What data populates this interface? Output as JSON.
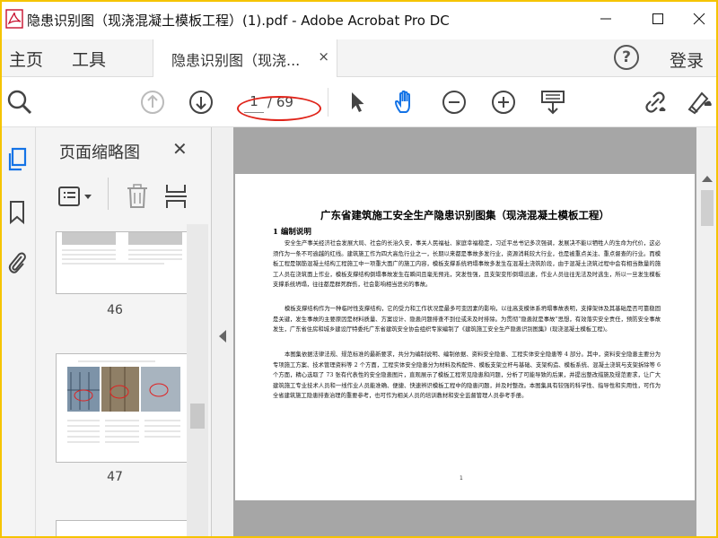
{
  "window": {
    "title": "隐患识别图（现浇混凝土模板工程）(1).pdf - Adobe Acrobat Pro DC"
  },
  "menu": {
    "home": "主页",
    "tools": "工具",
    "tab_label": "隐患识别图（现浇...",
    "tab_close": "×",
    "help": "?",
    "login": "登录"
  },
  "toolbar": {
    "current_page": "1",
    "total_pages": "/ 69"
  },
  "panel": {
    "title": "页面缩略图",
    "close": "✕",
    "thumbnails": [
      {
        "label": "46"
      },
      {
        "label": "47"
      }
    ]
  },
  "document": {
    "heading": "广东省建筑施工安全生产隐患识别图集（现浇混凝土模板工程）",
    "section": "1 编制说明",
    "paragraphs": [
      "安全生产事关经济社会发展大局、社会的长治久安，事关人民福祉、家庭幸福稳定，习近平总书记多次强调，发展决不能以牺牲人的生命为代价，这必须作为一条不可逾越的红线。建筑施工作为四大高危行业之一，长期以来都是事故多发行业，资源消耗较大行业，也是被重点关注、重点督查的行业。而模板工程是钢筋混凝土结构工程施工中一项重大面广的施工内容，模板支撑系统坍塌事故多发生在混凝土浇筑阶段，由于混凝土浇筑过程中会有相当数量的施工人员在浇筑面上作业，模板支撑结构倒塌事故发生在瞬间且毫无预兆，突发性强，且支架变形倒塌迅速，作业人员往往无法及时逃生，所以一旦发生模板支撑系统坍塌，往往都是群死群伤，社会影响相当恶劣的事故。",
      "模板支撑结构作为一种临时性支撑结构，它的受力和工作状况是最多可变因素的影响，以往高支模体系坍塌事故表明，支撑架体及其基础是否可靠稳固是关键，发生事故的主要原因是材料质量、方案设计、隐患问题排查不到位或未及时排除。为贯彻“隐患就是事故”思想，有效落实安全责任，预防安全事故发生，广东省住房和城乡建设厅特委托广东省建筑安全协会组织专家编制了《建筑施工安全生产隐患识别图集》(现浇混凝土模板工程)。",
      "本图集依据法律法规、规范标准的最新要求，共分为编制说明、编制依据、资料安全隐患、工程实体安全隐患等 4 部分。其中，资料安全隐患主要分为专项施工方案、技术管理资料等 2 个方面，工程实体安全隐患分为材料及构配件、模板支架立杆与基础、支架构造、模板系统、混凝土浇筑与支架拆除等 6 个方面，精心选取了 73 张有代表性的安全隐患图片，直观展示了模板工程常见隐患和问题，分析了可能导致的后果，并提出整改措施及规范要求，让广大建筑施工专业技术人员和一线作业人员能准确、便捷、快速辨识模板工程中的隐患问题，并及时整改。本图集具有较强的科学性、指导性和实用性，可作为全省建筑施工隐患排查治理的重要参考，也可作为相关人员的培训教材和安全监督管理人员参考手册。"
    ],
    "page_number": "1"
  }
}
